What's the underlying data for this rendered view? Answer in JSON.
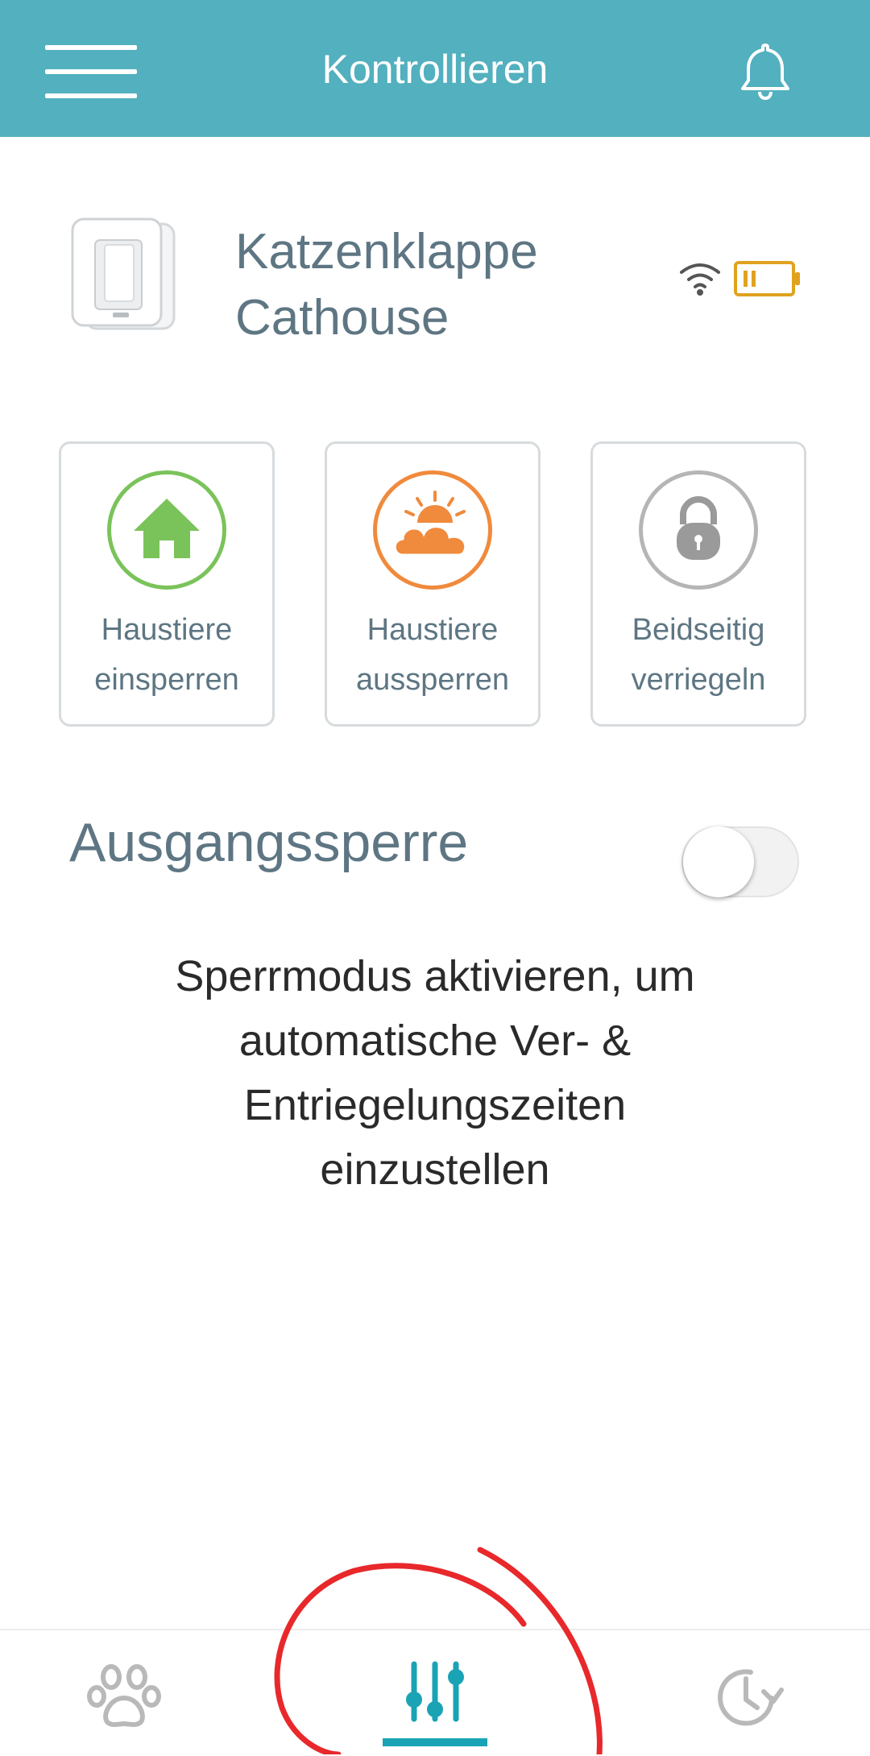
{
  "header": {
    "title": "Kontrollieren",
    "background_color": "#52b0bf"
  },
  "device": {
    "name_line1": "Katzenklappe",
    "name_line2": "Cathouse",
    "battery_color": "#e0a21f",
    "wifi_icon": "wifi-icon",
    "battery_icon": "battery-low-icon"
  },
  "modes": [
    {
      "line1": "Haustiere",
      "line2": "einsperren",
      "icon": "home-icon",
      "color": "#7ac35a"
    },
    {
      "line1": "Haustiere",
      "line2": "aussperren",
      "icon": "sun-cloud-icon",
      "color": "#f08a3c"
    },
    {
      "line1": "Beidseitig",
      "line2": "verriegeln",
      "icon": "padlock-icon",
      "color": "#b5b5b5"
    }
  ],
  "curfew": {
    "title": "Ausgangssperre",
    "enabled": false,
    "description_lines": [
      "Sperrmodus aktivieren, um",
      "automatische Ver- &",
      "Entriegelungszeiten",
      "einzustellen"
    ]
  },
  "bottom_nav": {
    "items": [
      {
        "icon": "paw-icon",
        "active": false
      },
      {
        "icon": "sliders-icon",
        "active": true
      },
      {
        "icon": "history-icon",
        "active": false
      }
    ],
    "active_color": "#1aa3b5",
    "inactive_color": "#b9b9b9"
  },
  "annotation_color": "#e8282b"
}
